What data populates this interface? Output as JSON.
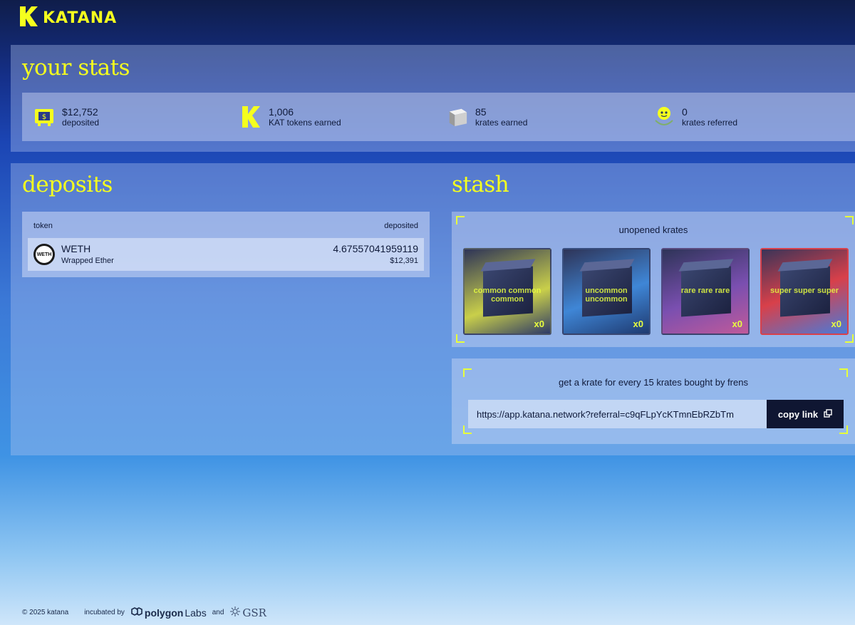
{
  "header": {
    "logo_text": "KATANA",
    "logo_icon": "katana-k-logo"
  },
  "stats": {
    "title": "your stats",
    "items": [
      {
        "value": "$12,752",
        "label": "deposited",
        "icon": "deposit-icon"
      },
      {
        "value": "1,006",
        "label": "KAT tokens earned",
        "icon": "kat-token-icon"
      },
      {
        "value": "85",
        "label": "krates earned",
        "icon": "krate-icon"
      },
      {
        "value": "0",
        "label": "krates referred",
        "icon": "referral-icon"
      }
    ]
  },
  "deposits": {
    "title": "deposits",
    "columns": {
      "token": "token",
      "deposited": "deposited"
    },
    "rows": [
      {
        "symbol": "WETH",
        "name": "Wrapped Ether",
        "amount": "4.67557041959119",
        "usd": "$12,391",
        "icon_text": "WETH"
      }
    ]
  },
  "stash": {
    "title": "stash",
    "krates_title": "unopened krates",
    "krates": [
      {
        "label": "common common common",
        "count": "x0",
        "color": "#c9cf4a"
      },
      {
        "label": "uncommon uncommon",
        "count": "x0",
        "color": "#3f86d6"
      },
      {
        "label": "rare rare rare",
        "count": "x0",
        "color": "#7a4fb0"
      },
      {
        "label": "super super super",
        "count": "x0",
        "color": "#d8404a"
      }
    ],
    "referral_title": "get a krate for every 15 krates bought by frens",
    "referral_link": "https://app.katana.network?referral=c9qFLpYcKTmnEbRZbTm",
    "copy_label": "copy link"
  },
  "footer": {
    "copyright": "© 2025 katana",
    "incubated": "incubated by",
    "polygon": "polygon",
    "labs": "Labs",
    "and": "and",
    "gsr": "GSR"
  }
}
